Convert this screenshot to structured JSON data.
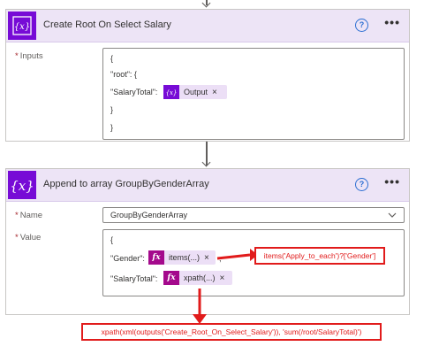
{
  "card1": {
    "title": "Create Root On Select Salary",
    "icon": "variable-icon",
    "inputs_label": "Inputs",
    "required_mark": "*",
    "code": {
      "line1": "{",
      "line2": "\"root\": {",
      "line3_prefix": "\"SalaryTotal\":",
      "token_text": "Output",
      "line4": "}",
      "line5": "}"
    },
    "help": "?",
    "more": "•••",
    "close": "×"
  },
  "card2": {
    "title": "Append to array GroupByGenderArray",
    "icon": "variable-icon",
    "name_label": "Name",
    "value_label": "Value",
    "required_mark": "*",
    "name_value": "GroupByGenderArray",
    "code": {
      "line1": "{",
      "gender_prefix": "\"Gender\":",
      "gender_token": "items(...)",
      "gender_suffix": ",",
      "salary_prefix": "\"SalaryTotal\":",
      "salary_token": "xpath(...)"
    },
    "help": "?",
    "more": "•••",
    "close": "×",
    "fx": "fx"
  },
  "annotations": {
    "gender_expression": "items('Apply_to_each')?['Gender']",
    "xpath_expression": "xpath(xml(outputs('Create_Root_On_Select_Salary')), 'sum(/root/SalaryTotal)')"
  },
  "colors": {
    "accent": "#770bd6",
    "header_bg": "#ede4f6",
    "token_bg": "#ecdff6",
    "fx_bg": "#a4098c",
    "annotation_red": "#e11b1b",
    "help_blue": "#2b6ed2"
  }
}
